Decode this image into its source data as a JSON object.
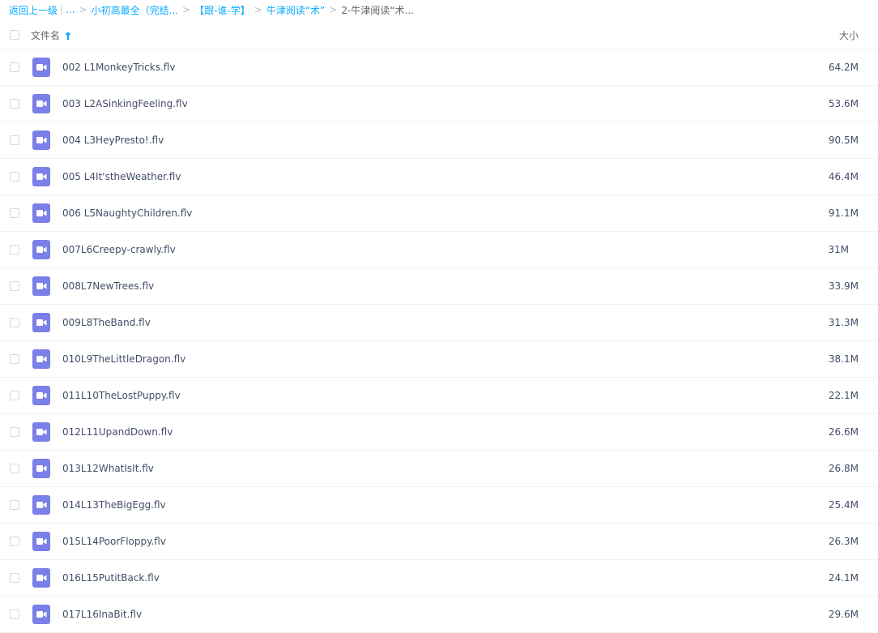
{
  "breadcrumb": {
    "back": "返回上一级",
    "ellipsis": "...",
    "crumbs": [
      "小初高最全（完结...",
      "【跟-谁-学】",
      "牛津阅读“术”"
    ],
    "current": "2-牛津阅读“术..."
  },
  "header": {
    "name_label": "文件名",
    "size_label": "大小"
  },
  "files": [
    {
      "name": "002 L1MonkeyTricks.flv",
      "size": "64.2M"
    },
    {
      "name": "003 L2ASinkingFeeling.flv",
      "size": "53.6M"
    },
    {
      "name": "004 L3HeyPresto!.flv",
      "size": "90.5M"
    },
    {
      "name": "005 L4It'stheWeather.flv",
      "size": "46.4M"
    },
    {
      "name": "006 L5NaughtyChildren.flv",
      "size": "91.1M"
    },
    {
      "name": "007L6Creepy-crawly.flv",
      "size": "31M"
    },
    {
      "name": "008L7NewTrees.flv",
      "size": "33.9M"
    },
    {
      "name": "009L8TheBand.flv",
      "size": "31.3M"
    },
    {
      "name": "010L9TheLittleDragon.flv",
      "size": "38.1M"
    },
    {
      "name": "011L10TheLostPuppy.flv",
      "size": "22.1M"
    },
    {
      "name": "012L11UpandDown.flv",
      "size": "26.6M"
    },
    {
      "name": "013L12WhatIsIt.flv",
      "size": "26.8M"
    },
    {
      "name": "014L13TheBigEgg.flv",
      "size": "25.4M"
    },
    {
      "name": "015L14PoorFloppy.flv",
      "size": "26.3M"
    },
    {
      "name": "016L15PutitBack.flv",
      "size": "24.1M"
    },
    {
      "name": "017L16InaBit.flv",
      "size": "29.6M"
    }
  ],
  "icons": {
    "video_file": "video-file-icon",
    "sort": "sort-ascending-icon"
  },
  "colors": {
    "accent": "#09aaff",
    "video_icon": "#7b7fe8"
  }
}
